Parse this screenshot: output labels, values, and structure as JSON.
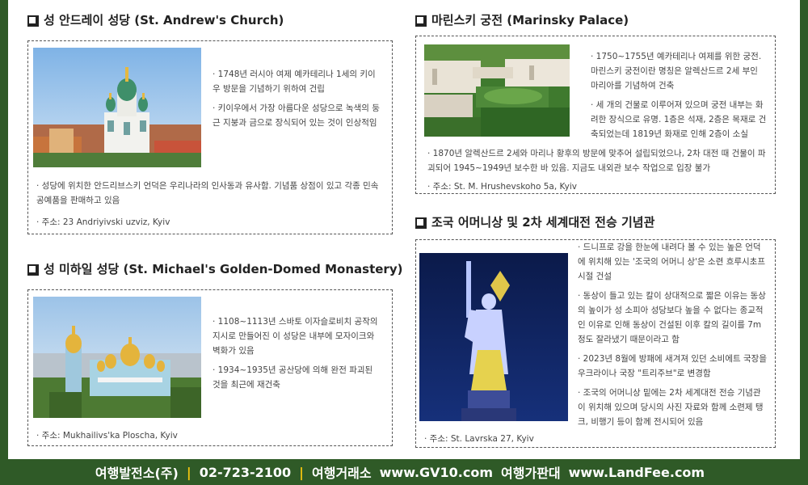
{
  "sections": {
    "andrew": {
      "title": "성 안드레이 성당 (St. Andrew's Church)",
      "bullets": [
        "· 1748년 러시아 여제 예카테리나 1세의 키이우 방문을 기념하기 위하여 건립",
        "· 키이우에서 가장 아름다운 성당으로 녹색의 둥근 지붕과 금으로 장식되어 있는 것이 인상적임"
      ],
      "bottom": "· 성당에 위치한 안드리브스키 언덕은 우리나라의 인사동과 유사함. 기념품 상점이 있고 각종 민속 공예품을 판매하고 있음",
      "address": "· 주소: 23 Andriyivski uzviz, Kyiv"
    },
    "michael": {
      "title": "성 미하일 성당 (St. Michael's Golden-Domed Monastery)",
      "bullets": [
        "· 1108~1113년 스바토 이자슬로비치 공작의 지시로 만들어진 이 성당은 내부에 모자이크와 벽화가 있음",
        "· 1934~1935년 공산당에 의해 완전 파괴된 것을 최근에 재건축"
      ],
      "address": "· 주소: Mukhailivs'ka Ploscha, Kyiv"
    },
    "marinsky": {
      "title": "마린스키 궁전 (Marinsky Palace)",
      "bullets": [
        "· 1750~1755년 예카테리나 여제를 위한 궁전. 마린스키 궁전이란 명칭은 알렉산드르 2세 부인 마리아를 기념하여 건축",
        "· 세 개의 건물로 이루어져 있으며 궁전 내부는 화려한 장식으로 유명. 1층은 석재, 2층은 목재로 건축되었는데 1819년 화재로 인해 2층이 소실"
      ],
      "bottom": "· 1870년 알렉산드르 2세와 마리나 황후의 방문에 맞추어 설립되었으나, 2차 대전 때 건물이 파괴되어 1945~1949년 보수한 바 있음. 지금도 내외관 보수 작업으로 입장 불가",
      "address": "· 주소: St. M. Hrushevskoho 5a, Kyiv"
    },
    "motherland": {
      "title": "조국 어머니상 및 2차 세계대전 전승 기념관",
      "bullets": [
        "· 드니프로 강을 한눈에 내려다 볼 수 있는 높은 언덕에 위치해 있는 '조국의 어머니 상'은 소련 흐루시초프시절 건설",
        "· 동상이 들고 있는 칼이 상대적으로 짧은 이유는 동상의 높이가 성 소피아 성당보다 높을 수 없다는 종교적인 이유로 인해 동상이 건설된 이후 칼의 길이를 7m 정도 잘라냈기 때문이라고 함",
        "· 2023년 8월에 방패에 새겨져 있던 소비에트 국장을 우크라이나 국장 \"트리주브\"로 변경함",
        "· 조국의 어머니상 밑에는 2차 세계대전 전승 기념관이 위치해 있으며 당시의 사진 자료와 함께 소련제 탱크, 비행기 등이 함께 전시되어 있음"
      ],
      "address": "· 주소: St. Lavrska 27, Kyiv"
    }
  },
  "footer": {
    "company": "여행발전소(주)",
    "phone": "02-723-2100",
    "label1": "여행거래소",
    "url1": "www.GV10.com",
    "label2": "여행가판대",
    "url2": "www.LandFee.com",
    "separator": "|",
    "accent_color": "#f1c40f"
  }
}
